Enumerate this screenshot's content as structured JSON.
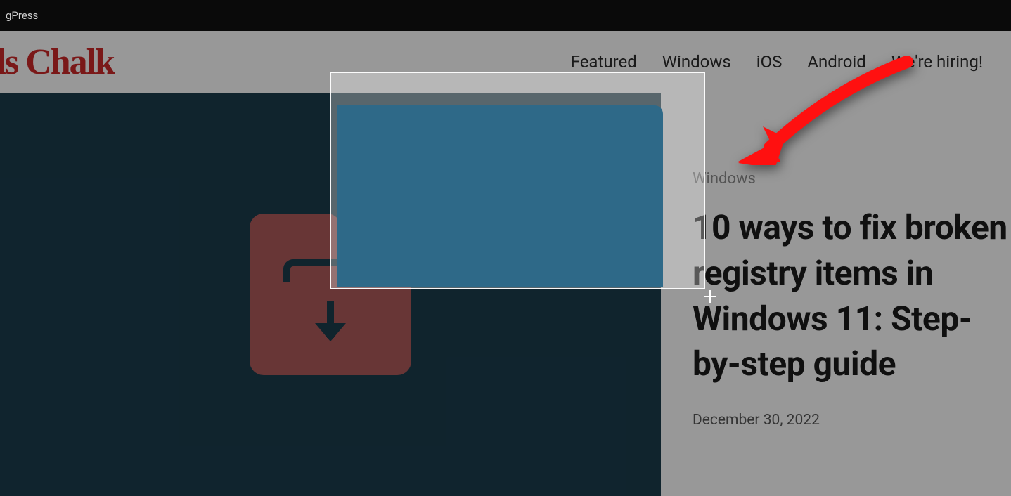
{
  "topbar": {
    "text": "gPress"
  },
  "header": {
    "logo": "ds Chalk",
    "nav": [
      {
        "label": "Featured"
      },
      {
        "label": "Windows"
      },
      {
        "label": "iOS"
      },
      {
        "label": "Android"
      },
      {
        "label": "We're hiring!"
      }
    ]
  },
  "article": {
    "category": "Windows",
    "title": "10 ways to fix broken registry items in Windows 11: Step-by-step guide",
    "date": "December 30, 2022"
  },
  "annotation": {
    "arrow_color": "#ff0000"
  }
}
